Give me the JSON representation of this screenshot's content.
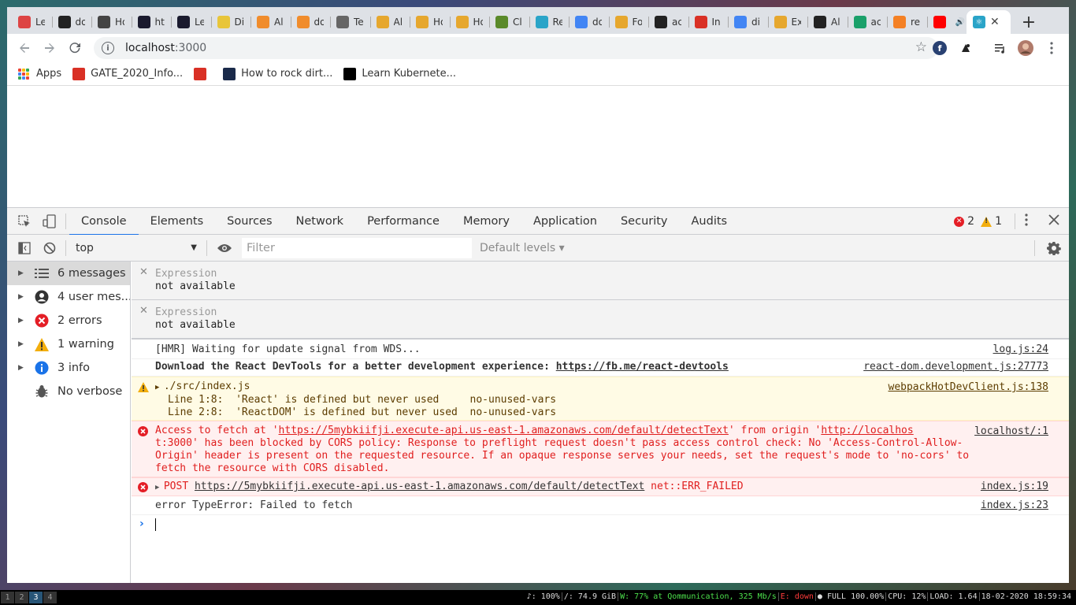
{
  "tabs": [
    {
      "title": "Le",
      "icon": "red-favicon",
      "color": "#d44"
    },
    {
      "title": "do",
      "icon": "github-icon",
      "color": "#222"
    },
    {
      "title": "Ho",
      "icon": "penguin-icon",
      "color": "#444"
    },
    {
      "title": "ht",
      "icon": "vercel-icon",
      "color": "#1a1a2e"
    },
    {
      "title": "Le",
      "icon": "vercel-icon",
      "color": "#1a1a2e"
    },
    {
      "title": "Di",
      "icon": "ejs-icon",
      "color": "#e8c53a"
    },
    {
      "title": "Al",
      "icon": "box-icon",
      "color": "#f08c2c"
    },
    {
      "title": "do",
      "icon": "lambda-icon",
      "color": "#f08c2c"
    },
    {
      "title": "Te",
      "icon": "globe-icon",
      "color": "#666"
    },
    {
      "title": "Al",
      "icon": "box-icon",
      "color": "#e6a72e"
    },
    {
      "title": "Ho",
      "icon": "box-icon",
      "color": "#e6a72e"
    },
    {
      "title": "Ho",
      "icon": "box-icon",
      "color": "#e6a72e"
    },
    {
      "title": "Cl",
      "icon": "hat-icon",
      "color": "#5a8a2a"
    },
    {
      "title": "Re",
      "icon": "react-icon",
      "color": "#2aa4c8"
    },
    {
      "title": "do",
      "icon": "google-icon",
      "color": "#4285f4"
    },
    {
      "title": "Fo",
      "icon": "box-icon",
      "color": "#e6a72e"
    },
    {
      "title": "ac",
      "icon": "github-icon",
      "color": "#222"
    },
    {
      "title": "In",
      "icon": "gmail-icon",
      "color": "#d93025"
    },
    {
      "title": "di",
      "icon": "google-icon",
      "color": "#4285f4"
    },
    {
      "title": "Ex",
      "icon": "box-icon",
      "color": "#e6a72e"
    },
    {
      "title": "Al",
      "icon": "github-icon",
      "color": "#222"
    },
    {
      "title": "ac",
      "icon": "green-icon",
      "color": "#1aa06a"
    },
    {
      "title": "re",
      "icon": "stackoverflow-icon",
      "color": "#f48024"
    },
    {
      "title": "",
      "icon": "youtube-icon",
      "color": "#ff0000"
    }
  ],
  "active_tab": {
    "icon": "react-icon",
    "color": "#2aa4c8"
  },
  "address": {
    "host": "localhost",
    "port": ":3000"
  },
  "bookmarks": [
    {
      "label": "Apps",
      "icon": "apps-grid-icon"
    },
    {
      "label": "GATE_2020_Info...",
      "icon": "pdf-icon",
      "color": "#d93025"
    },
    {
      "label": "",
      "icon": "red-bookmark-icon",
      "color": "#d93025"
    },
    {
      "label": "How to rock dirt...",
      "icon": "terminal-icon",
      "color": "#1a2a4a"
    },
    {
      "label": "Learn Kubernete...",
      "icon": "dev-icon",
      "color": "#000"
    }
  ],
  "devtools": {
    "tabs": [
      "Console",
      "Elements",
      "Sources",
      "Network",
      "Performance",
      "Memory",
      "Application",
      "Security",
      "Audits"
    ],
    "active_tab": "Console",
    "error_count": "2",
    "warning_count": "1",
    "context": "top",
    "filter_placeholder": "Filter",
    "levels": "Default levels ▾"
  },
  "sidebar": [
    {
      "label": "6 messages",
      "icon": "list-icon",
      "selected": true
    },
    {
      "label": "4 user mes...",
      "icon": "user-icon"
    },
    {
      "label": "2 errors",
      "icon": "error-icon"
    },
    {
      "label": "1 warning",
      "icon": "warning-icon"
    },
    {
      "label": "3 info",
      "icon": "info-icon"
    },
    {
      "label": "No verbose",
      "icon": "bug-icon"
    }
  ],
  "expressions": [
    {
      "name": "Expression",
      "value": "not available"
    },
    {
      "name": "Expression",
      "value": "not available"
    }
  ],
  "messages": {
    "hmr": {
      "text": "[HMR] Waiting for update signal from WDS...",
      "source": "log.js:24"
    },
    "devtools_hint": {
      "text": "Download the React DevTools for a better development experience: ",
      "link": "https://fb.me/react-devtools",
      "source": "react-dom.development.js:27773"
    },
    "warning": {
      "file": "./src/index.js",
      "line1": "Line 1:8:  'React' is defined but never used     no-unused-vars",
      "line2": "Line 2:8:  'ReactDOM' is defined but never used  no-unused-vars",
      "source": "webpackHotDevClient.js:138"
    },
    "cors": {
      "prefix": "Access to fetch at '",
      "url": "https://5mybkiifji.execute-api.us-east-1.amazonaws.com/default/detectText",
      "mid": "' from origin '",
      "origin": "http://localhos",
      "source": "localhost/:1",
      "line2": "t:3000' has been blocked by CORS policy: Response to preflight request doesn't pass access control check: No 'Access-Control-Allow-",
      "line3": "Origin' header is present on the requested resource. If an opaque response serves your needs, set the request's mode to 'no-cors' to",
      "line4": "fetch the resource with CORS disabled."
    },
    "post": {
      "method": "POST",
      "url": "https://5mybkiifji.execute-api.us-east-1.amazonaws.com/default/detectText",
      "status": "net::ERR_FAILED",
      "source": "index.js:19"
    },
    "typeerror": {
      "text": "error TypeError: Failed to fetch",
      "source": "index.js:23"
    }
  },
  "statusbar": {
    "workspaces": [
      "1",
      "2",
      "3",
      "4"
    ],
    "active_workspace": "3",
    "volume": "♪: 100%",
    "disk": "/: 74.9 GiB",
    "wifi": "W: 77% at Qommunication, 325 Mb/s",
    "ethernet": "E: down",
    "battery": "● FULL 100.00%",
    "cpu": "CPU: 12%",
    "load": "LOAD: 1.64",
    "datetime": "18-02-2020 18:59:34"
  }
}
